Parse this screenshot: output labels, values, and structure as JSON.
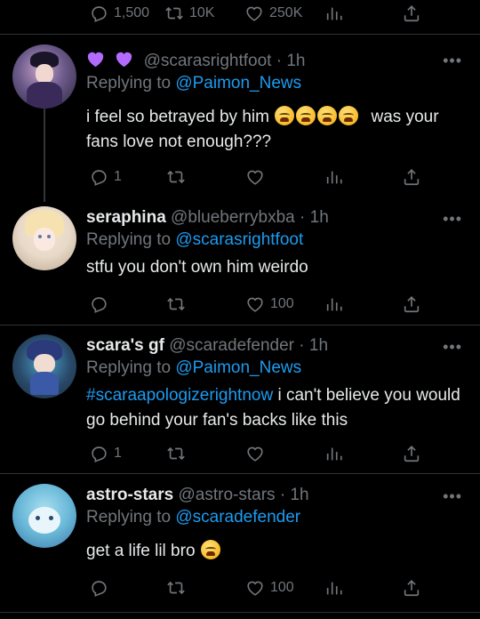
{
  "top_stats": {
    "replies": "1,500",
    "retweets": "10K",
    "likes": "250K"
  },
  "tweets": [
    {
      "display_name_emoji": "💜 💜",
      "handle": "@scarasrightfoot",
      "time": "1h",
      "reply_prefix": "Replying to",
      "reply_to": "@Paimon_News",
      "text": "i feel so betrayed by him",
      "text_after": "was your fans love not enough???",
      "replies": "1",
      "likes": "",
      "avatar_colors": [
        "#6b5a8a",
        "#c8a2c8",
        "#2a2238"
      ]
    },
    {
      "name": "seraphina",
      "handle": "@blueberrybxba",
      "time": "1h",
      "reply_prefix": "Replying to",
      "reply_to": "@scarasrightfoot",
      "text": "stfu you don't own him weirdo",
      "replies": "",
      "likes": "100",
      "avatar_colors": [
        "#e8d9c8",
        "#f2e6d6",
        "#b8a890"
      ]
    },
    {
      "name": "scara's gf",
      "handle": "@scaradefender",
      "time": "1h",
      "reply_prefix": "Replying to",
      "reply_to": "@Paimon_News",
      "hashtag": "#scaraapologizerightnow",
      "text": "i can't believe you would go behind your fan's backs like this",
      "replies": "1",
      "likes": "",
      "avatar_colors": [
        "#2a4a6a",
        "#4aa0c8",
        "#1a2a3a"
      ]
    },
    {
      "name": "astro-stars",
      "handle": "@astro-stars",
      "time": "1h",
      "reply_prefix": "Replying to",
      "reply_to": "@scaradefender",
      "text": "get a life lil bro",
      "replies": "",
      "likes": "100",
      "avatar_colors": [
        "#6ab8d8",
        "#a8e0f0",
        "#3a78a8"
      ]
    }
  ],
  "icons": {
    "reply": "reply-icon",
    "retweet": "retweet-icon",
    "like": "heart-icon",
    "views": "analytics-icon",
    "share": "share-icon",
    "more": "more-icon"
  },
  "colors": {
    "background": "#000000",
    "text": "#e7e9ea",
    "muted": "#71767b",
    "link": "#1d9bf0",
    "divider": "#2f3336",
    "heart_purple": "#b36bff"
  }
}
